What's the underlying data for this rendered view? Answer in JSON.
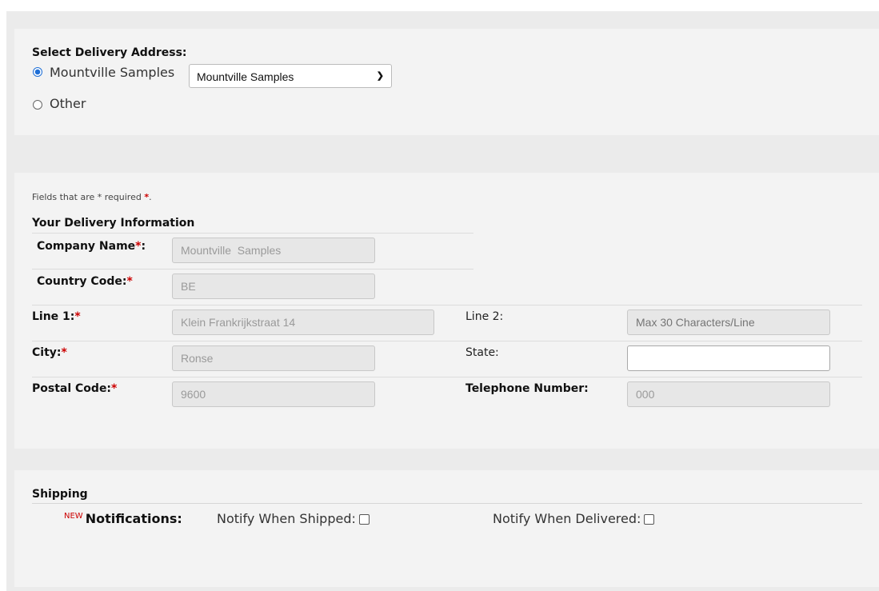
{
  "delivery": {
    "title": "Select Delivery Address:",
    "options": [
      {
        "label": "Mountville Samples",
        "checked": true
      },
      {
        "label": "Other",
        "checked": false
      }
    ],
    "select_value": "Mountville Samples"
  },
  "form": {
    "required_note": "Fields that are * required ",
    "required_star": "*",
    "required_dot": ".",
    "section_title": "Your Delivery Information",
    "required_marker": "*",
    "company_name": {
      "label": "Company Name",
      "suffix": ":",
      "value": "Mountville  Samples"
    },
    "country_code": {
      "label": "Country Code:",
      "value": "BE"
    },
    "line1": {
      "label": "Line 1:",
      "value": "Klein Frankrijkstraat 14"
    },
    "line2": {
      "label": "Line 2:",
      "placeholder": "Max 30 Characters/Line"
    },
    "city": {
      "label": "City:",
      "value": "Ronse"
    },
    "state": {
      "label": "State:",
      "value": ""
    },
    "postal_code": {
      "label": "Postal Code:",
      "value": "9600"
    },
    "telephone": {
      "label": "Telephone Number:",
      "value": "000"
    }
  },
  "shipping": {
    "title": "Shipping",
    "new_badge": "NEW",
    "notifications_label": "Notifications:",
    "notify_shipped": "Notify When Shipped:",
    "notify_delivered": "Notify When Delivered:"
  }
}
